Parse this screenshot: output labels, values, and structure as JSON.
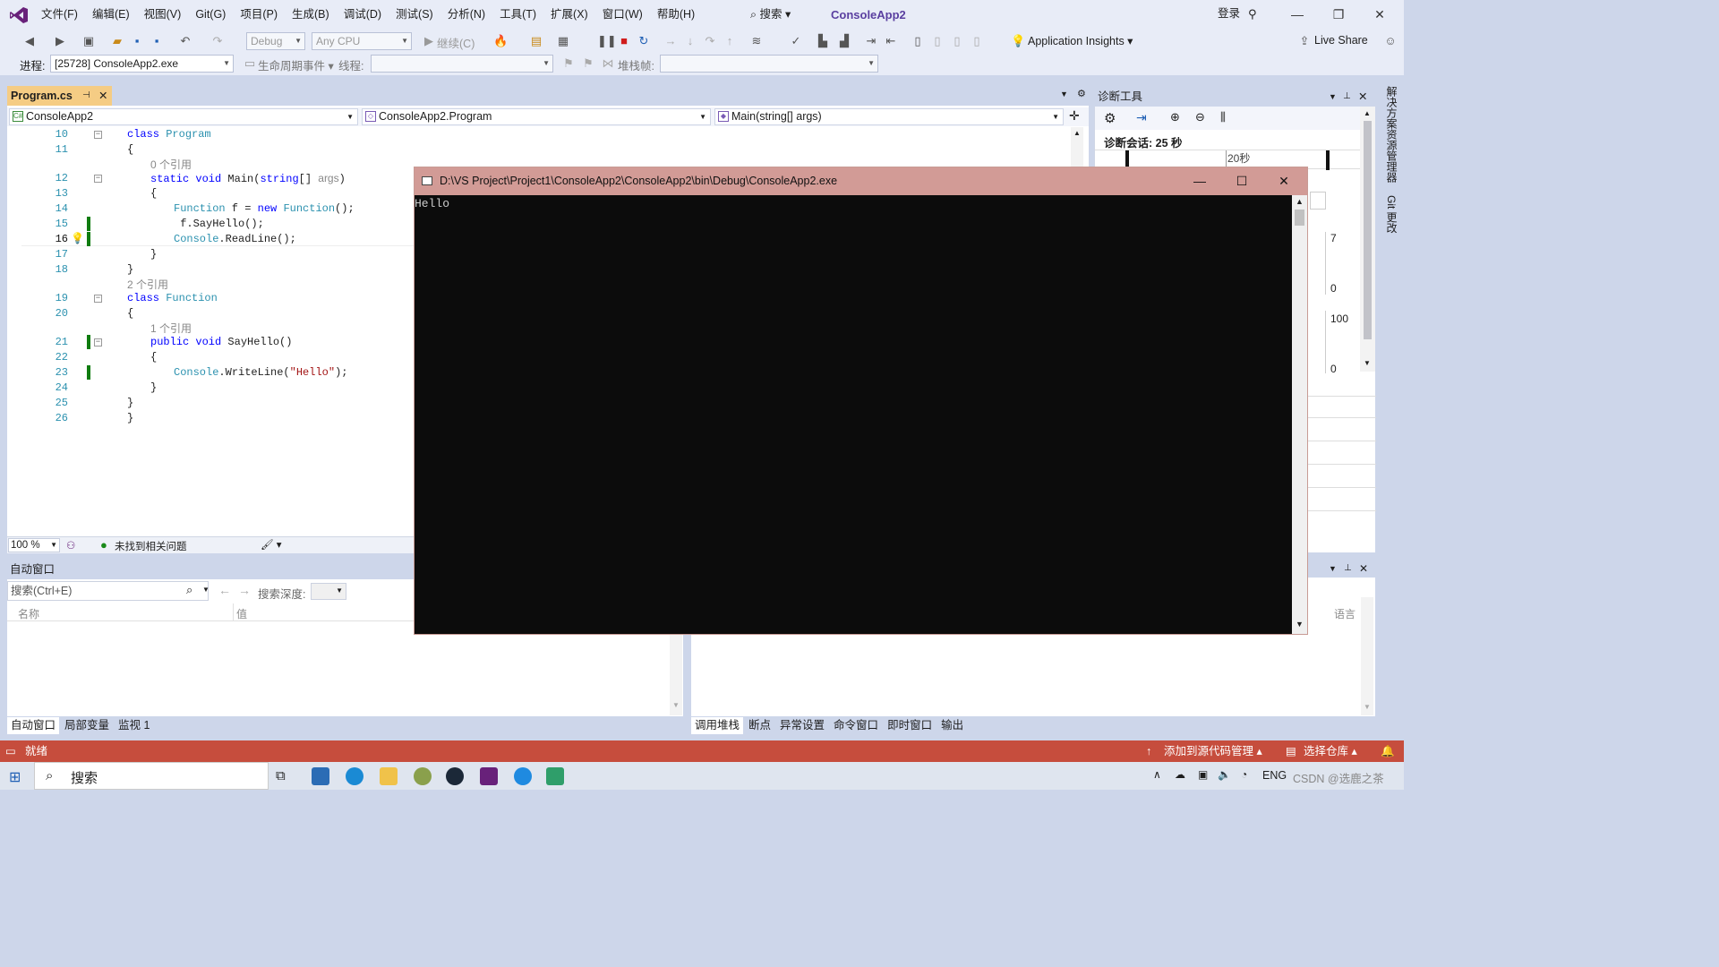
{
  "menu": {
    "items": [
      "文件(F)",
      "编辑(E)",
      "视图(V)",
      "Git(G)",
      "项目(P)",
      "生成(B)",
      "调试(D)",
      "测试(S)",
      "分析(N)",
      "工具(T)",
      "扩展(X)",
      "窗口(W)",
      "帮助(H)"
    ],
    "search": "搜索",
    "app_title": "ConsoleApp2",
    "login": "登录"
  },
  "toolbar": {
    "config": "Debug",
    "platform": "Any CPU",
    "continue": "继续(C)",
    "app_insights": "Application Insights",
    "live_share": "Live Share"
  },
  "toolbar2": {
    "process_label": "进程:",
    "process_value": "[25728] ConsoleApp2.exe",
    "lifecycle": "生命周期事件",
    "thread_label": "线程:",
    "stack_label": "堆栈帧:"
  },
  "editor": {
    "tab": "Program.cs",
    "nav_project": "ConsoleApp2",
    "nav_class": "ConsoleApp2.Program",
    "nav_member": "Main(string[] args)",
    "zoom": "100 %",
    "issues": "未找到相关问题"
  },
  "code": [
    {
      "n": "10",
      "parts": [
        [
          "kw",
          "class "
        ],
        [
          "ty",
          "Program"
        ]
      ],
      "indent": 0
    },
    {
      "n": "11",
      "parts": [
        [
          "",
          "{"
        ]
      ],
      "indent": 0
    },
    {
      "ref": "0 个引用",
      "indent": 1
    },
    {
      "n": "12",
      "parts": [
        [
          "kw",
          "static void "
        ],
        [
          "",
          "Main("
        ],
        [
          "kw",
          "string"
        ],
        [
          "",
          "[] "
        ],
        [
          "ref",
          "args"
        ],
        [
          "",
          ")"
        ]
      ],
      "indent": 1
    },
    {
      "n": "13",
      "parts": [
        [
          "",
          "{"
        ]
      ],
      "indent": 1
    },
    {
      "n": "14",
      "parts": [
        [
          "ty",
          "Function"
        ],
        [
          "",
          " f = "
        ],
        [
          "kw",
          "new "
        ],
        [
          "ty",
          "Function"
        ],
        [
          "",
          "();"
        ]
      ],
      "indent": 2
    },
    {
      "n": "15",
      "parts": [
        [
          "",
          " f.SayHello();"
        ]
      ],
      "indent": 2
    },
    {
      "n": "16",
      "parts": [
        [
          "ty",
          "Console"
        ],
        [
          "",
          ".ReadLine();"
        ]
      ],
      "indent": 2
    },
    {
      "n": "17",
      "parts": [
        [
          "",
          "}"
        ]
      ],
      "indent": 1
    },
    {
      "n": "18",
      "parts": [
        [
          "",
          "}"
        ]
      ],
      "indent": 0
    },
    {
      "ref": "2 个引用",
      "indent": 0
    },
    {
      "n": "19",
      "parts": [
        [
          "kw",
          "class "
        ],
        [
          "ty",
          "Function"
        ]
      ],
      "indent": 0
    },
    {
      "n": "20",
      "parts": [
        [
          "",
          "{"
        ]
      ],
      "indent": 0
    },
    {
      "ref": "1 个引用",
      "indent": 1
    },
    {
      "n": "21",
      "parts": [
        [
          "kw",
          "public void "
        ],
        [
          "",
          "SayHello()"
        ]
      ],
      "indent": 1
    },
    {
      "n": "22",
      "parts": [
        [
          "",
          "{"
        ]
      ],
      "indent": 1
    },
    {
      "n": "23",
      "parts": [
        [
          "ty",
          "Console"
        ],
        [
          "",
          ".WriteLine("
        ],
        [
          "st",
          "\"Hello\""
        ],
        [
          "",
          ");"
        ]
      ],
      "indent": 2
    },
    {
      "n": "24",
      "parts": [
        [
          "",
          "}"
        ]
      ],
      "indent": 1
    },
    {
      "n": "25",
      "parts": [
        [
          "",
          "}"
        ]
      ],
      "indent": 0
    },
    {
      "n": "26",
      "parts": [
        [
          "",
          "}"
        ]
      ],
      "indent": 0
    }
  ],
  "diagnostics": {
    "title": "诊断工具",
    "session": "诊断会话: 25 秒",
    "timeline_label": "20秒",
    "v1": "7",
    "v2": "0",
    "v3": "100",
    "v4": "0"
  },
  "console": {
    "title": "D:\\VS Project\\Project1\\ConsoleApp2\\ConsoleApp2\\bin\\Debug\\ConsoleApp2.exe",
    "output": "Hello"
  },
  "auto": {
    "title": "自动窗口",
    "search_placeholder": "搜索(Ctrl+E)",
    "depth_label": "搜索深度:",
    "col_name": "名称",
    "col_value": "值",
    "tabs": [
      "自动窗口",
      "局部变量",
      "监视 1"
    ]
  },
  "rightpanel": {
    "col_lang": "语言",
    "tabs": [
      "调用堆栈",
      "断点",
      "异常设置",
      "命令窗口",
      "即时窗口",
      "输出"
    ]
  },
  "rightstrip": {
    "items": [
      "解决方案资源管理器",
      "Git 更改"
    ]
  },
  "status": {
    "ready": "就绪",
    "source_control": "添加到源代码管理",
    "repo": "选择仓库"
  },
  "taskbar": {
    "search": "搜索",
    "lang": "ENG",
    "watermark": "CSDN @选鹿之茶"
  }
}
